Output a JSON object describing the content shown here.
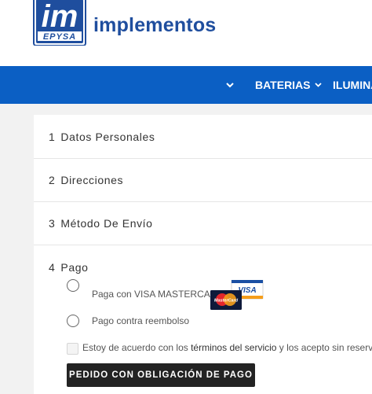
{
  "brand": {
    "name": "implementos",
    "logo_text": "im",
    "logo_subtext": "EPYSA"
  },
  "nav": {
    "items": [
      {
        "label": "BATERIAS",
        "icon": "chevron-down-icon"
      },
      {
        "label": "ILUMINA",
        "icon": ""
      }
    ],
    "leading_icon": "chevron-down-icon"
  },
  "checkout": {
    "steps": [
      {
        "number": "1",
        "title": "Datos Personales"
      },
      {
        "number": "2",
        "title": "Direcciones"
      },
      {
        "number": "3",
        "title": "Método De Envío"
      },
      {
        "number": "4",
        "title": "Pago"
      }
    ],
    "payment": {
      "options": [
        {
          "label": "Paga con VISA MASTERCARD",
          "icons": [
            "visa-icon",
            "mastercard-icon"
          ],
          "selected": false
        },
        {
          "label": "Pago contra reembolso",
          "selected": false
        }
      ],
      "card_logo_text": {
        "visa": "VISA",
        "mastercard": "MasterCard"
      },
      "terms": {
        "prefix": "Estoy de acuerdo con los ",
        "link": "términos del servicio",
        "suffix": " y los acepto sin reservas.",
        "checked": false
      },
      "submit_label": "PEDIDO CON OBLIGACIÓN DE PAGO"
    }
  },
  "colors": {
    "brand_blue": "#1f4e9e",
    "nav_blue": "#0b5fc4",
    "button_dark": "#232323",
    "visa_blue": "#1a4fa3",
    "mastercard_red": "#e3262b",
    "mastercard_yellow": "#f59e1b"
  }
}
